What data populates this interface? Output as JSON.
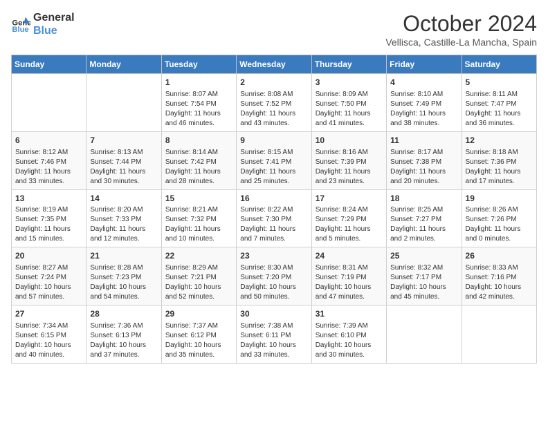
{
  "header": {
    "logo_line1": "General",
    "logo_line2": "Blue",
    "month": "October 2024",
    "location": "Vellisca, Castille-La Mancha, Spain"
  },
  "days_of_week": [
    "Sunday",
    "Monday",
    "Tuesday",
    "Wednesday",
    "Thursday",
    "Friday",
    "Saturday"
  ],
  "weeks": [
    [
      {
        "day": "",
        "info": ""
      },
      {
        "day": "",
        "info": ""
      },
      {
        "day": "1",
        "info": "Sunrise: 8:07 AM\nSunset: 7:54 PM\nDaylight: 11 hours and 46 minutes."
      },
      {
        "day": "2",
        "info": "Sunrise: 8:08 AM\nSunset: 7:52 PM\nDaylight: 11 hours and 43 minutes."
      },
      {
        "day": "3",
        "info": "Sunrise: 8:09 AM\nSunset: 7:50 PM\nDaylight: 11 hours and 41 minutes."
      },
      {
        "day": "4",
        "info": "Sunrise: 8:10 AM\nSunset: 7:49 PM\nDaylight: 11 hours and 38 minutes."
      },
      {
        "day": "5",
        "info": "Sunrise: 8:11 AM\nSunset: 7:47 PM\nDaylight: 11 hours and 36 minutes."
      }
    ],
    [
      {
        "day": "6",
        "info": "Sunrise: 8:12 AM\nSunset: 7:46 PM\nDaylight: 11 hours and 33 minutes."
      },
      {
        "day": "7",
        "info": "Sunrise: 8:13 AM\nSunset: 7:44 PM\nDaylight: 11 hours and 30 minutes."
      },
      {
        "day": "8",
        "info": "Sunrise: 8:14 AM\nSunset: 7:42 PM\nDaylight: 11 hours and 28 minutes."
      },
      {
        "day": "9",
        "info": "Sunrise: 8:15 AM\nSunset: 7:41 PM\nDaylight: 11 hours and 25 minutes."
      },
      {
        "day": "10",
        "info": "Sunrise: 8:16 AM\nSunset: 7:39 PM\nDaylight: 11 hours and 23 minutes."
      },
      {
        "day": "11",
        "info": "Sunrise: 8:17 AM\nSunset: 7:38 PM\nDaylight: 11 hours and 20 minutes."
      },
      {
        "day": "12",
        "info": "Sunrise: 8:18 AM\nSunset: 7:36 PM\nDaylight: 11 hours and 17 minutes."
      }
    ],
    [
      {
        "day": "13",
        "info": "Sunrise: 8:19 AM\nSunset: 7:35 PM\nDaylight: 11 hours and 15 minutes."
      },
      {
        "day": "14",
        "info": "Sunrise: 8:20 AM\nSunset: 7:33 PM\nDaylight: 11 hours and 12 minutes."
      },
      {
        "day": "15",
        "info": "Sunrise: 8:21 AM\nSunset: 7:32 PM\nDaylight: 11 hours and 10 minutes."
      },
      {
        "day": "16",
        "info": "Sunrise: 8:22 AM\nSunset: 7:30 PM\nDaylight: 11 hours and 7 minutes."
      },
      {
        "day": "17",
        "info": "Sunrise: 8:24 AM\nSunset: 7:29 PM\nDaylight: 11 hours and 5 minutes."
      },
      {
        "day": "18",
        "info": "Sunrise: 8:25 AM\nSunset: 7:27 PM\nDaylight: 11 hours and 2 minutes."
      },
      {
        "day": "19",
        "info": "Sunrise: 8:26 AM\nSunset: 7:26 PM\nDaylight: 11 hours and 0 minutes."
      }
    ],
    [
      {
        "day": "20",
        "info": "Sunrise: 8:27 AM\nSunset: 7:24 PM\nDaylight: 10 hours and 57 minutes."
      },
      {
        "day": "21",
        "info": "Sunrise: 8:28 AM\nSunset: 7:23 PM\nDaylight: 10 hours and 54 minutes."
      },
      {
        "day": "22",
        "info": "Sunrise: 8:29 AM\nSunset: 7:21 PM\nDaylight: 10 hours and 52 minutes."
      },
      {
        "day": "23",
        "info": "Sunrise: 8:30 AM\nSunset: 7:20 PM\nDaylight: 10 hours and 50 minutes."
      },
      {
        "day": "24",
        "info": "Sunrise: 8:31 AM\nSunset: 7:19 PM\nDaylight: 10 hours and 47 minutes."
      },
      {
        "day": "25",
        "info": "Sunrise: 8:32 AM\nSunset: 7:17 PM\nDaylight: 10 hours and 45 minutes."
      },
      {
        "day": "26",
        "info": "Sunrise: 8:33 AM\nSunset: 7:16 PM\nDaylight: 10 hours and 42 minutes."
      }
    ],
    [
      {
        "day": "27",
        "info": "Sunrise: 7:34 AM\nSunset: 6:15 PM\nDaylight: 10 hours and 40 minutes."
      },
      {
        "day": "28",
        "info": "Sunrise: 7:36 AM\nSunset: 6:13 PM\nDaylight: 10 hours and 37 minutes."
      },
      {
        "day": "29",
        "info": "Sunrise: 7:37 AM\nSunset: 6:12 PM\nDaylight: 10 hours and 35 minutes."
      },
      {
        "day": "30",
        "info": "Sunrise: 7:38 AM\nSunset: 6:11 PM\nDaylight: 10 hours and 33 minutes."
      },
      {
        "day": "31",
        "info": "Sunrise: 7:39 AM\nSunset: 6:10 PM\nDaylight: 10 hours and 30 minutes."
      },
      {
        "day": "",
        "info": ""
      },
      {
        "day": "",
        "info": ""
      }
    ]
  ]
}
